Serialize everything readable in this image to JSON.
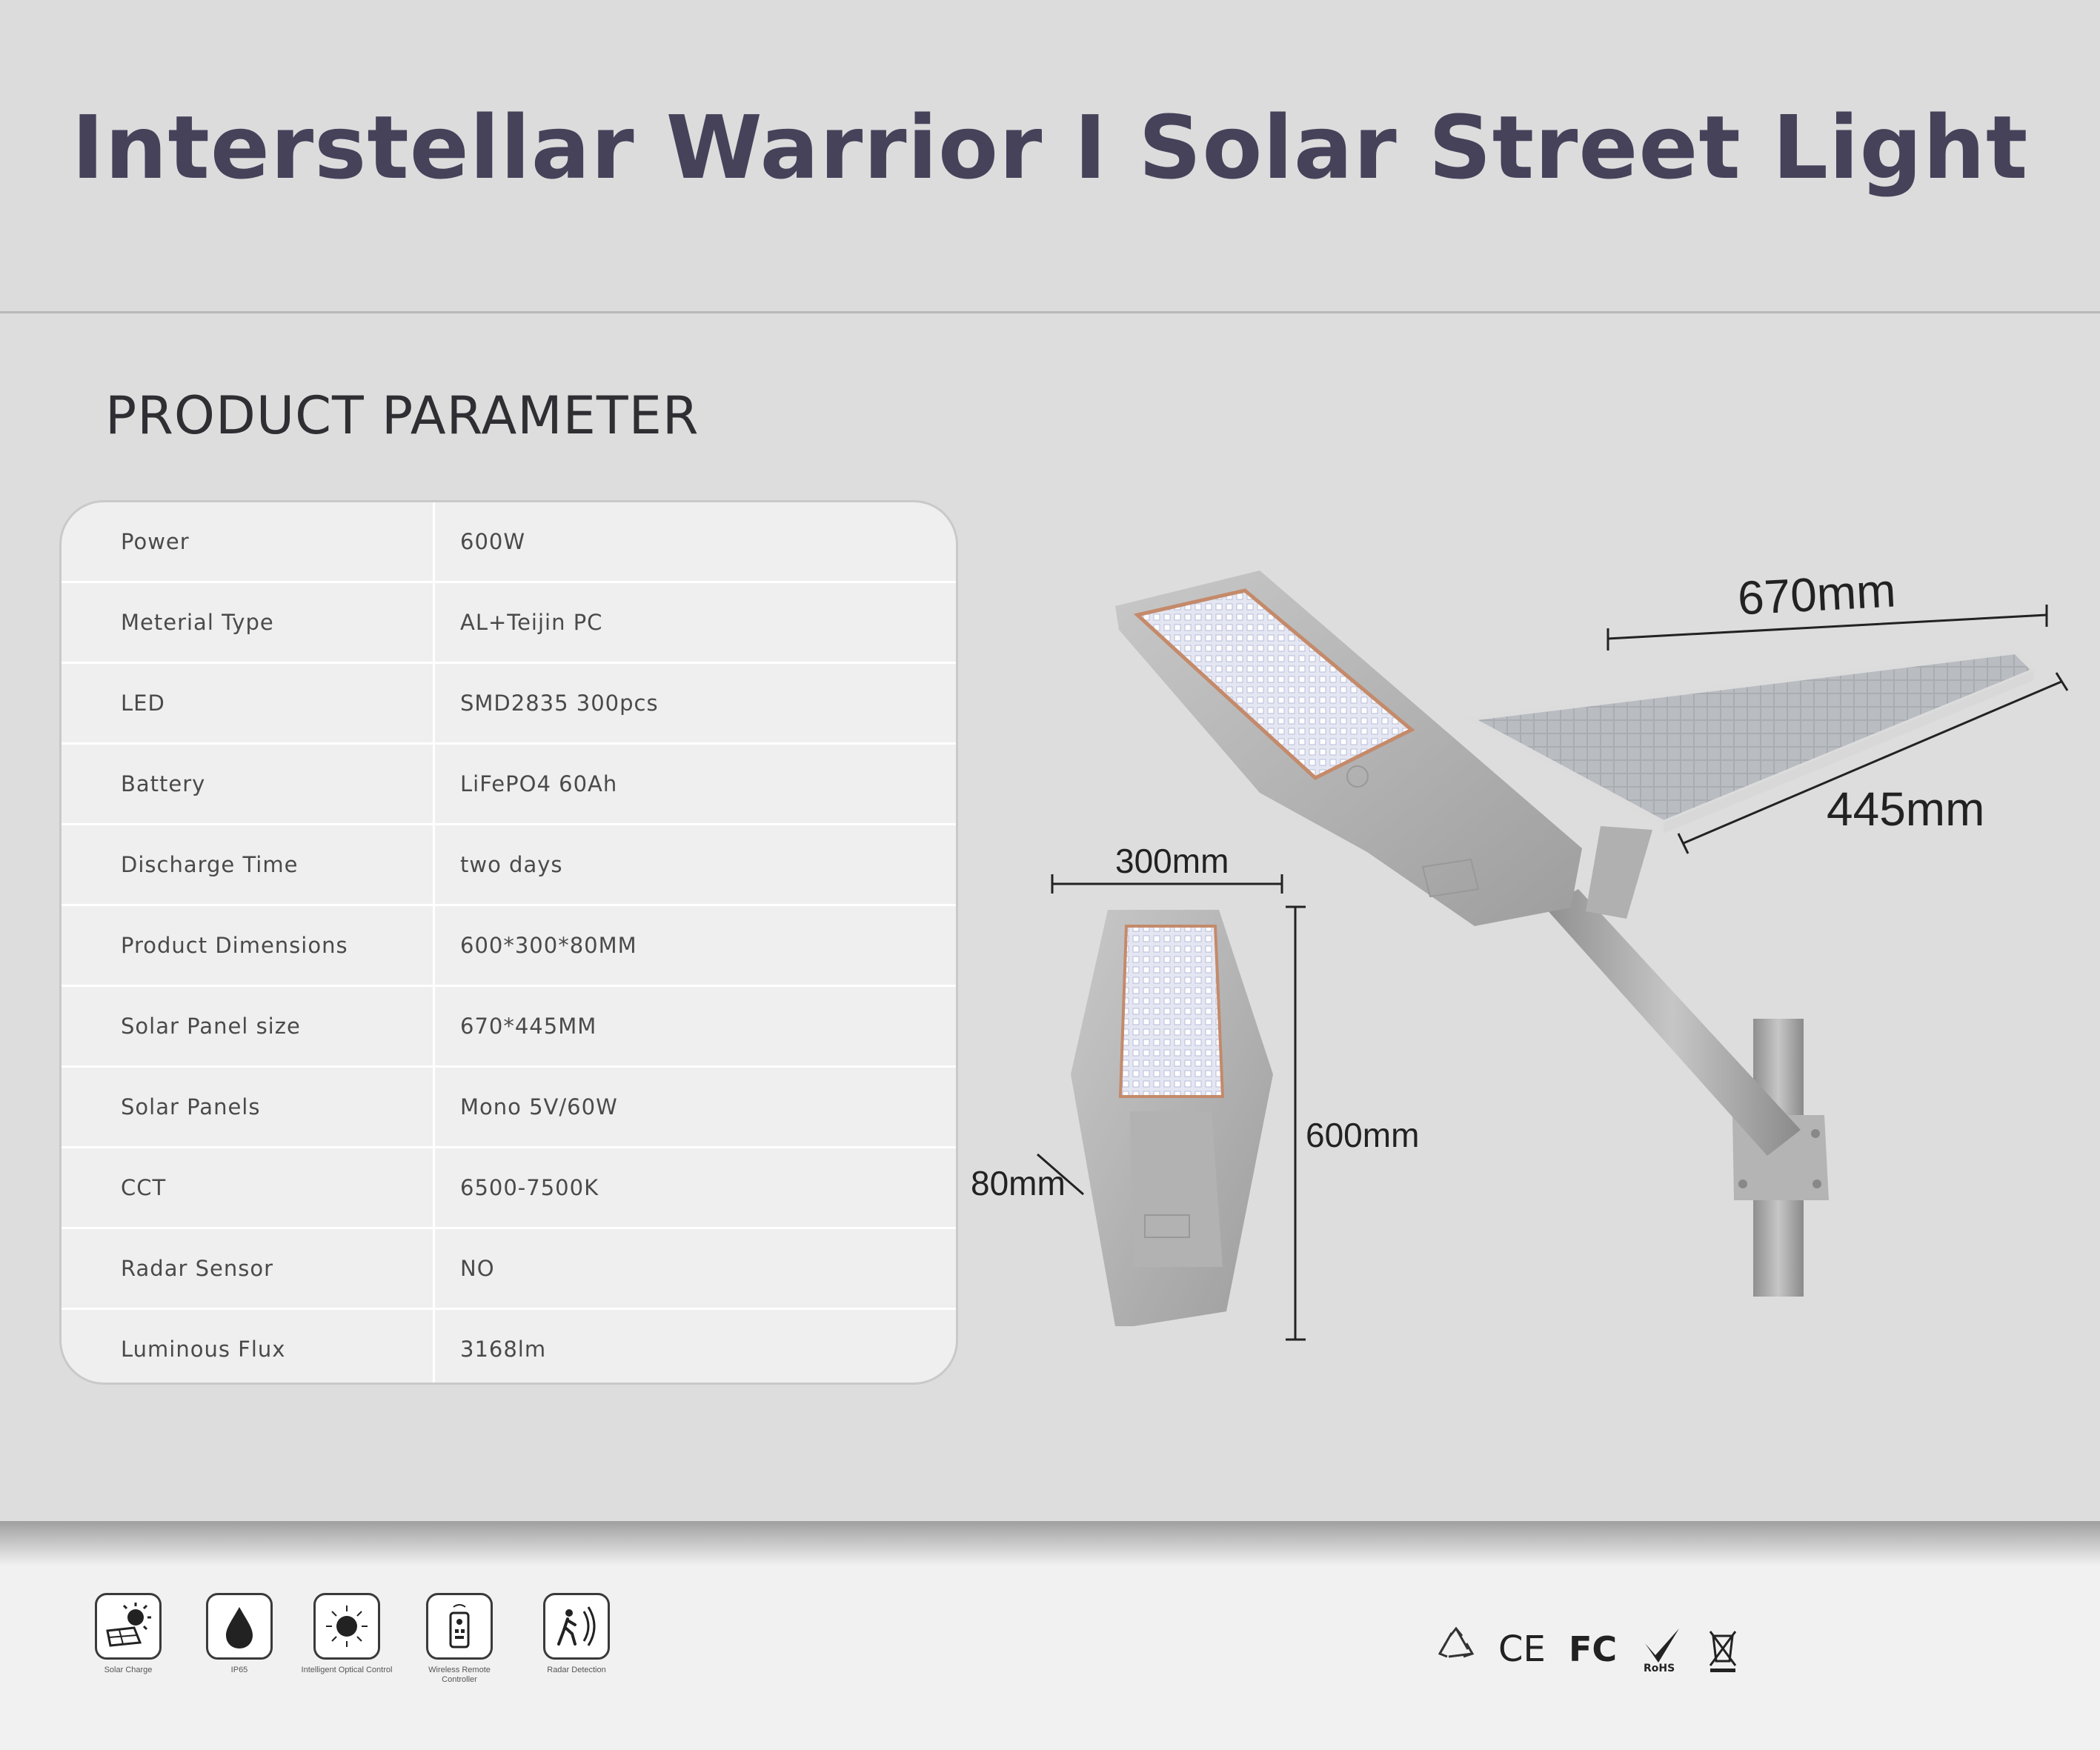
{
  "page_title": "Interstellar Warrior I Solar Street Light",
  "section_title": "PRODUCT PARAMETER",
  "parameters": [
    {
      "label": "Power",
      "value": "600W"
    },
    {
      "label": "Meterial Type",
      "value": "AL+Teijin PC"
    },
    {
      "label": "LED",
      "value": "SMD2835 300pcs"
    },
    {
      "label": "Battery",
      "value": "LiFePO4 60Ah"
    },
    {
      "label": "Discharge Time",
      "value": "two days"
    },
    {
      "label": "Product Dimensions",
      "value": "600*300*80MM"
    },
    {
      "label": "Solar Panel size",
      "value": "670*445MM"
    },
    {
      "label": "Solar Panels",
      "value": "Mono 5V/60W"
    },
    {
      "label": "CCT",
      "value": "6500-7500K"
    },
    {
      "label": "Radar Sensor",
      "value": "NO"
    },
    {
      "label": "Luminous Flux",
      "value": "3168lm"
    }
  ],
  "dimensions": {
    "panel_width": "670mm",
    "panel_depth": "445mm",
    "lamp_width": "300mm",
    "lamp_length": "600mm",
    "lamp_thickness": "80mm"
  },
  "features": [
    {
      "icon": "solar-charge-icon",
      "label": "Solar Charge"
    },
    {
      "icon": "water-drop-icon",
      "label": "IP65"
    },
    {
      "icon": "sun-icon",
      "label": "Intelligent Optical Control"
    },
    {
      "icon": "remote-control-icon",
      "label": "Wireless Remote  Controller"
    },
    {
      "icon": "radar-detection-icon",
      "label": "Radar Detection"
    }
  ],
  "certifications": [
    "CE",
    "FC",
    "RoHS"
  ],
  "colors": {
    "title": "#45425a",
    "background": "#dddddd",
    "table_bg": "#efefef",
    "footer_bg": "#f1f1f1"
  }
}
